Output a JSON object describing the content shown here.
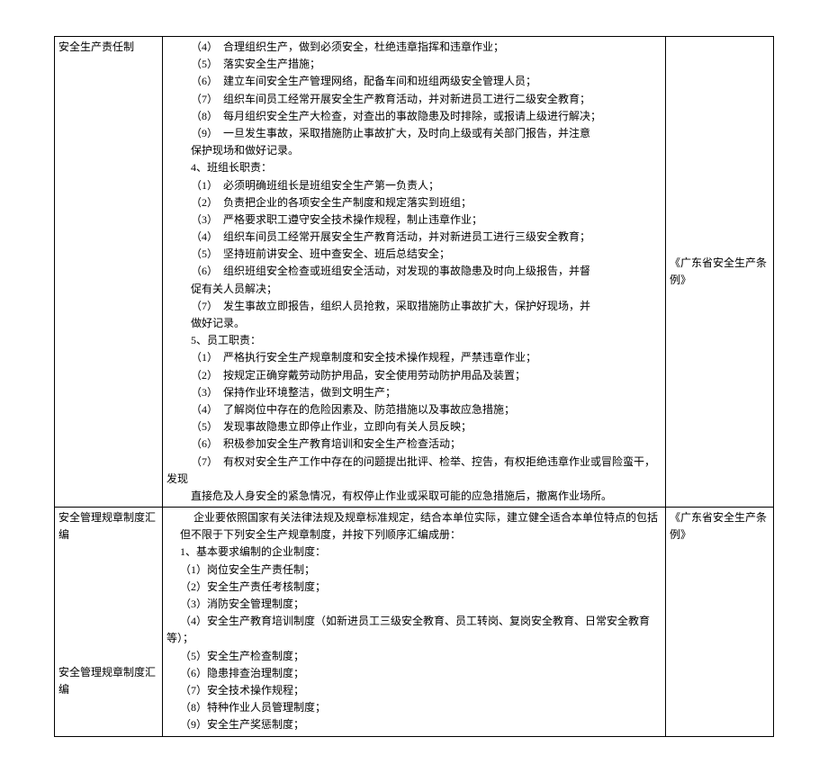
{
  "row1": {
    "label": "安全生产责任制",
    "content": "         （4）  合理组织生产，做到必须安全，杜绝违章指挥和违章作业；\n         （5）  落实安全生产措施；\n         （6）  建立车间安全生产管理网络，配备车间和班组两级安全管理人员；\n         （7）  组织车间员工经常开展安全生产教育活动，并对新进员工进行二级安全教育；\n         （8）  每月组织安全生产大检查，对查出的事故隐患及时排除，或报请上级进行解决；\n         （9）  一旦发生事故，采取措施防止事故扩大，及时向上级或有关部门报告，并注意\n         保护现场和做好记录。\n         4、班组长职责：\n         （1）  必须明确班组长是班组安全生产第一负责人；\n         （2）  负责把企业的各项安全生产制度和规定落实到班组；\n         （3）  严格要求职工遵守安全技术操作规程，制止违章作业；\n         （4）  组织车间员工经常开展安全生产教育活动，并对新进员工进行三级安全教育；\n         （5）  坚持班前讲安全、班中查安全、班后总结安全；\n         （6）  组织班组安全检查或班组安全活动，对发现的事故隐患及时向上级报告，并督\n         促有关人员解决；\n         （7）  发生事故立即报告，组织人员抢救，采取措施防止事故扩大，保护好现场，并\n         做好记录。\n         5、员工职责：\n         （1）  严格执行安全生产规章制度和安全技术操作规程，严禁违章作业；\n         （2）  按规定正确穿戴劳动防护用品，安全使用劳动防护用品及装置；\n         （3）  保持作业环境整洁，做到文明生产；\n         （4）  了解岗位中存在的危险因素及、防范措施以及事故应急措施；\n         （5）  发现事故隐患立即停止作业，立即向有关人员反映；\n         （6）  积极参加安全生产教育培训和安全生产检查活动；\n         （7）  有权对安全生产工作中存在的问题提出批评、检举、控告，有权拒绝违章作业或冒险蛮干，发现\n         直接危及人身安全的紧急情况，有权停止作业或采取可能的应急措施后，撤离作业场所。",
    "ref": "《广东省安全生产条例》"
  },
  "row2": {
    "label_top": "安全管理规章制度汇编",
    "label_bottom": "安全管理规章制度汇编",
    "content": "          企业要依照国家有关法律法规及规章标准规定，结合本单位实际，建立健全适合本单位特点的包括\n     但不限于下列安全生产规章制度，并按下列顺序汇编成册：\n     1、基本要求编制的企业制度：\n     （1）岗位安全生产责任制；\n     （2）安全生产责任考核制度；\n     （3）消防安全管理制度；\n     （4）安全生产教育培训制度（如新进员工三级安全教育、员工转岗、复岗安全教育、日常安全教育等）；\n     （5）安全生产检查制度；\n     （6）隐患排查治理制度；\n     （7）安全技术操作规程；\n     （8）特种作业人员管理制度；\n     （9）安全生产奖惩制度；",
    "ref": "《广东省安全生产条例》"
  }
}
